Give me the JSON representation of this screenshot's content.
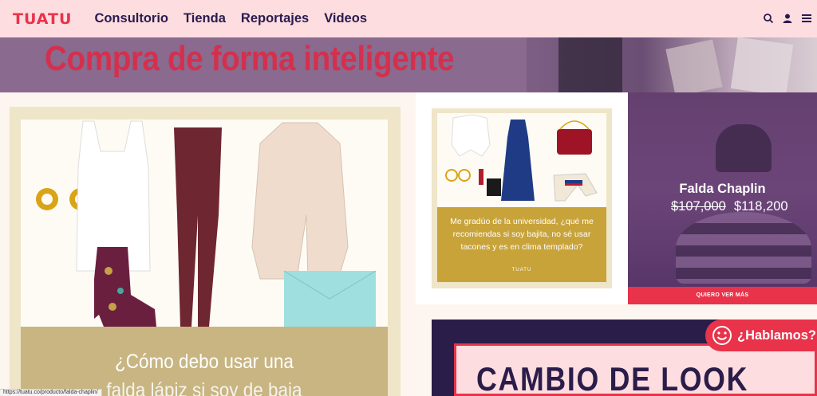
{
  "header": {
    "logo": "TUATU",
    "nav": [
      "Consultorio",
      "Tienda",
      "Reportajes",
      "Videos"
    ],
    "icons": [
      "search-icon",
      "user-icon",
      "menu-icon"
    ]
  },
  "banner": {
    "title": "Compra de forma inteligente"
  },
  "left_card": {
    "caption_line1": "¿Cómo debo usar una",
    "caption_line2": "falda lápiz si soy de baja"
  },
  "mid_card": {
    "caption": "Me gradúo de la universidad, ¿qué me recomiendas si soy bajita, no sé usar tacones y es en clima templado?",
    "brand": "TUATU"
  },
  "product": {
    "name": "Falda Chaplin",
    "old_price": "$107,000",
    "new_price": "$118,200",
    "cta": "QUIERO VER MÁS"
  },
  "look_card": {
    "title": "CAMBIO DE LOOK"
  },
  "chat": {
    "label": "¿Hablamos?"
  },
  "status_bar": {
    "url": "https://tuatu.co/producto/falda-chaplin/"
  },
  "colors": {
    "accent": "#e8334a",
    "header_bg": "#fddde0",
    "navy": "#2a1b4e",
    "gold": "#c8a33a"
  }
}
